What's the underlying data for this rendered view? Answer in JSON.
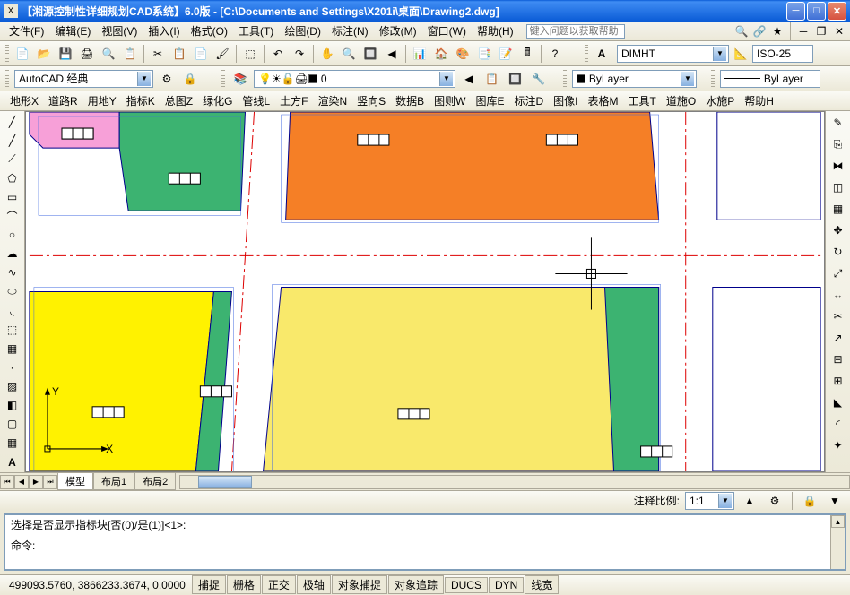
{
  "title": "【湘源控制性详细规划CAD系统】6.0版 - [C:\\Documents and Settings\\X201i\\桌面\\Drawing2.dwg]",
  "app_icon": "X",
  "menus": [
    "文件(F)",
    "编辑(E)",
    "视图(V)",
    "插入(I)",
    "格式(O)",
    "工具(T)",
    "绘图(D)",
    "标注(N)",
    "修改(M)",
    "窗口(W)",
    "帮助(H)"
  ],
  "help_placeholder": "键入问题以获取帮助",
  "workspace_combo": "AutoCAD 经典",
  "layer_name": "0",
  "dim_combo": "DIMHT",
  "iso_combo": "ISO-25",
  "bylayer1": "ByLayer",
  "bylayer2": "ByLayer",
  "menutabs": [
    "地形X",
    "道路R",
    "用地Y",
    "指标K",
    "总图Z",
    "绿化G",
    "管线L",
    "土方F",
    "渲染N",
    "竖向S",
    "数据B",
    "图则W",
    "图库E",
    "标注D",
    "图像I",
    "表格M",
    "工具T",
    "道施O",
    "水施P",
    "帮助H"
  ],
  "viewtabs": [
    "模型",
    "布局1",
    "布局2"
  ],
  "annotation_label": "注释比例:",
  "annotation_scale": "1:1",
  "cmd_line1": "选择是否显示指标块[否(0)/是(1)]<1>:",
  "cmd_line2": "命令:",
  "coords": "499093.5760, 3866233.3674, 0.0000",
  "status_buttons": [
    "捕捉",
    "栅格",
    "正交",
    "极轴",
    "对象捕捉",
    "对象追踪",
    "DUCS",
    "DYN",
    "线宽"
  ],
  "ucs": {
    "y": "Y",
    "x": "X"
  }
}
